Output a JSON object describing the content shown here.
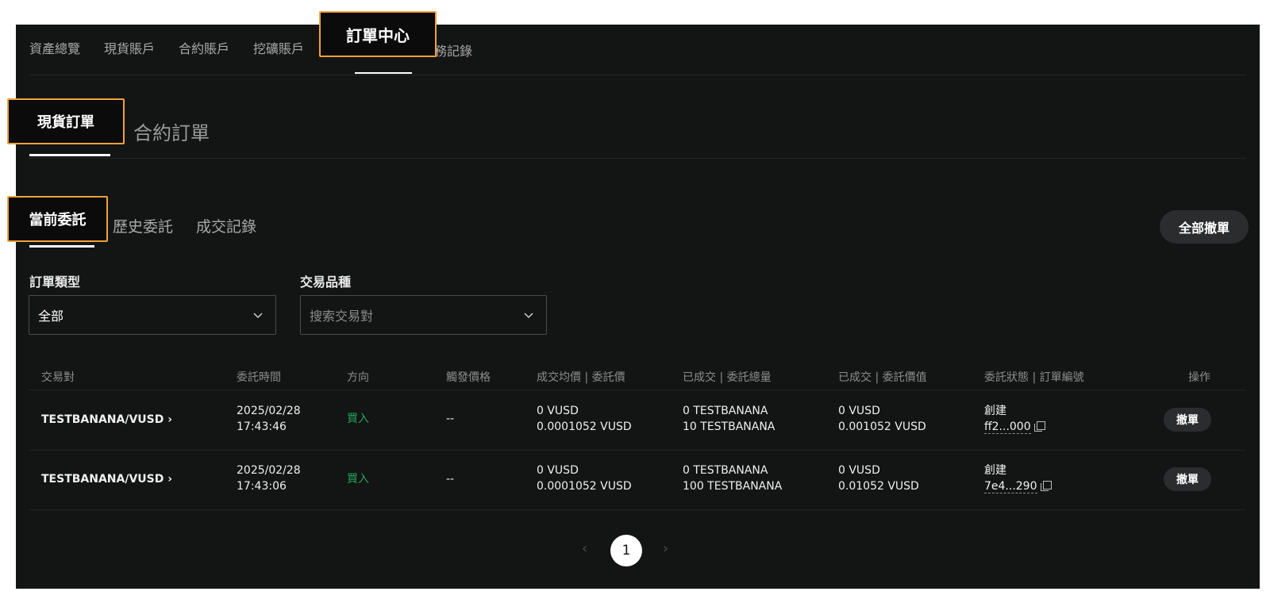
{
  "top_nav": {
    "items": [
      "資產總覽",
      "現貨賬戶",
      "合約賬戶",
      "挖礦賬戶",
      "訂單中心",
      "財務記錄"
    ],
    "active": "訂單中心",
    "partial_labels": {
      "mining": "挖礦賬戶",
      "finance": "務記錄"
    }
  },
  "order_tabs": {
    "spot": "現貨訂單",
    "futures": "合約訂單"
  },
  "sub_tabs": {
    "current": "當前委託",
    "history": "歷史委託",
    "trades": "成交記錄"
  },
  "cancel_all_label": "全部撤單",
  "filters": {
    "order_type": {
      "label": "訂單類型",
      "value": "全部"
    },
    "symbol": {
      "label": "交易品種",
      "placeholder": "搜索交易對"
    }
  },
  "table": {
    "headers": [
      "交易對",
      "委託時間",
      "方向",
      "觸發價格",
      "成交均價 | 委託價",
      "已成交 | 委託總量",
      "已成交 | 委託價值",
      "委託狀態 | 訂單編號",
      "操作"
    ],
    "rows": [
      {
        "pair": "TESTBANANA/VUSD",
        "date": "2025/02/28",
        "time": "17:43:46",
        "side": "買入",
        "trigger": "--",
        "avg_price": "0 VUSD",
        "order_price": "0.0001052 VUSD",
        "filled": "0 TESTBANANA",
        "total": "10 TESTBANANA",
        "filled_value": "0 VUSD",
        "order_value": "0.001052 VUSD",
        "status": "創建",
        "order_id": "ff2...000",
        "action": "撤單"
      },
      {
        "pair": "TESTBANANA/VUSD",
        "date": "2025/02/28",
        "time": "17:43:06",
        "side": "買入",
        "trigger": "--",
        "avg_price": "0 VUSD",
        "order_price": "0.0001052 VUSD",
        "filled": "0 TESTBANANA",
        "total": "100 TESTBANANA",
        "filled_value": "0 VUSD",
        "order_value": "0.01052 VUSD",
        "status": "創建",
        "order_id": "7e4...290",
        "action": "撤單"
      }
    ]
  },
  "pagination": {
    "current_page": "1",
    "prev": "‹",
    "next": "›"
  },
  "callouts": {
    "order_center": "訂單中心",
    "spot_orders": "現貨訂單",
    "current_orders": "當前委託"
  },
  "colors": {
    "background": "#131414",
    "buy": "#22a55a",
    "callout_border": "#f0a23a"
  }
}
